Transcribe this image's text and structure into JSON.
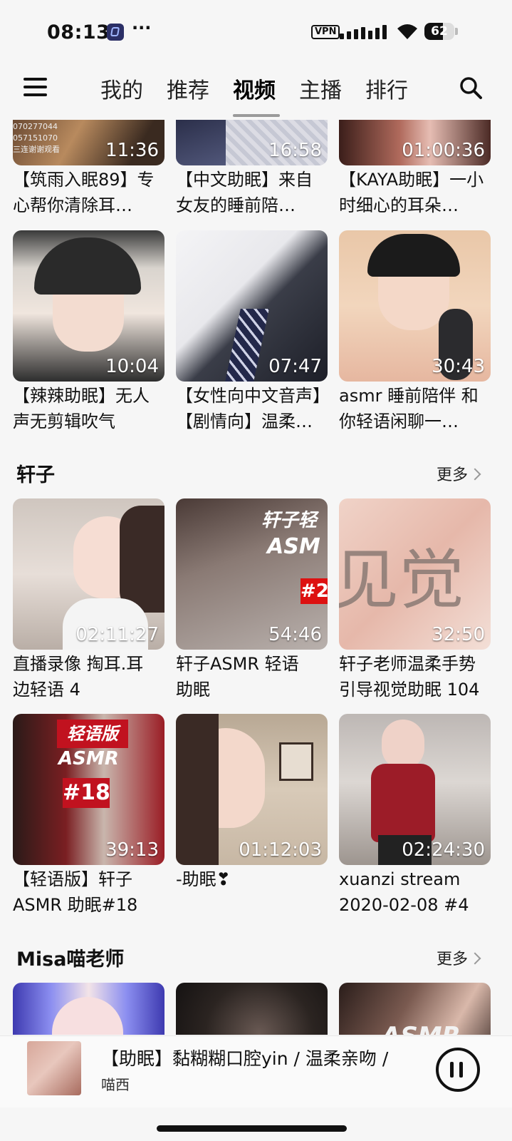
{
  "status_bar": {
    "time": "08:13",
    "dots": "···",
    "vpn": "VPN",
    "battery": "62",
    "battery_level": 0.62
  },
  "header": {
    "tabs": [
      {
        "label": "我的"
      },
      {
        "label": "推荐"
      },
      {
        "label": "视频",
        "active": true
      },
      {
        "label": "主播"
      },
      {
        "label": "排行"
      }
    ]
  },
  "top_section": {
    "videos": [
      {
        "duration": "11:36",
        "title_l1": "【筑雨入眠89】专",
        "title_l2": "心帮你清除耳…"
      },
      {
        "duration": "16:58",
        "title_l1": "【中文助眠】来自",
        "title_l2": "女友的睡前陪…"
      },
      {
        "duration": "01:00:36",
        "title_l1": "【KAYA助眠】一小",
        "title_l2": "时细心的耳朵…"
      },
      {
        "duration": "10:04",
        "title_l1": "【辣辣助眠】无人",
        "title_l2": "声无剪辑吹气"
      },
      {
        "duration": "07:47",
        "title_l1": "【女性向中文音声】",
        "title_l2": "【剧情向】温柔…"
      },
      {
        "duration": "30:43",
        "title_l1": "asmr 睡前陪伴 和",
        "title_l2": "你轻语闲聊一…"
      }
    ]
  },
  "section_xuanzi": {
    "title": "轩子",
    "more": "更多",
    "videos": [
      {
        "duration": "02:11:27",
        "title_l1": "直播录像 掏耳.耳",
        "title_l2": "边轻语 4"
      },
      {
        "duration": "54:46",
        "title_l1": "轩子ASMR 轻语",
        "title_l2": "助眠"
      },
      {
        "duration": "32:50",
        "title_l1": "轩子老师温柔手势",
        "title_l2": "引导视觉助眠 104"
      },
      {
        "duration": "39:13",
        "title_l1": "【轻语版】轩子",
        "title_l2": "ASMR 助眠#18"
      },
      {
        "duration": "01:12:03",
        "title_l1": "-助眠❣",
        "title_l2": ""
      },
      {
        "duration": "02:24:30",
        "title_l1": " xuanzi stream",
        "title_l2": "2020-02-08 #4"
      }
    ]
  },
  "section_misa": {
    "title": "Misa喵老师",
    "more": "更多"
  },
  "thumb_text": {
    "xz2_title": "轩子轻",
    "xz2_sub": "ASM",
    "xz2_badge": "#2",
    "xz3_big": "见觉",
    "xz4_line1": "轻语版",
    "xz4_line2": "ASMR",
    "xz4_line3": "#18",
    "m3_text": "ASMR"
  },
  "player": {
    "title": "【助眠】黏糊糊口腔yin / 温柔亲吻 / ",
    "artist": "喵西"
  },
  "colors": {
    "background": "#f6f6f6",
    "text": "#111111",
    "muted": "#9a9a9a"
  }
}
